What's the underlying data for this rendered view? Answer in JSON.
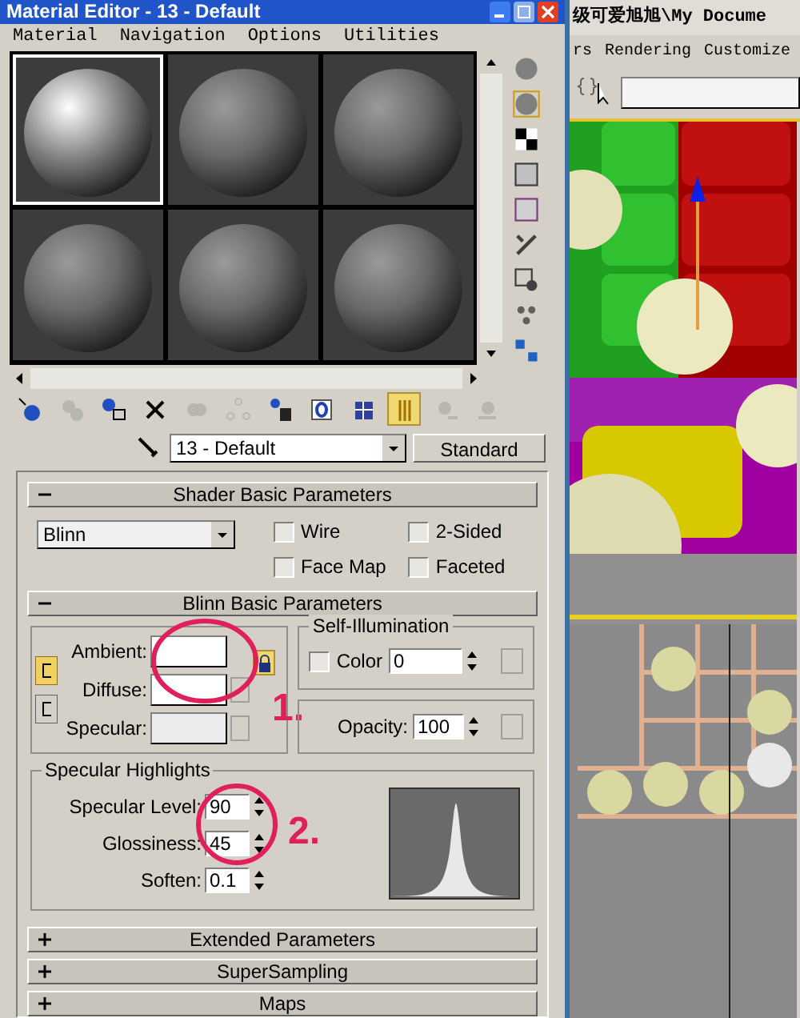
{
  "material_editor": {
    "title": "Material Editor - 13 - Default",
    "menu": [
      "Material",
      "Navigation",
      "Options",
      "Utilities"
    ],
    "sample_slots": [
      {
        "selected": true
      },
      {
        "selected": false
      },
      {
        "selected": false
      },
      {
        "selected": false
      },
      {
        "selected": false
      },
      {
        "selected": false
      }
    ],
    "toolbar": [
      {
        "pressed": false,
        "disabled": false
      },
      {
        "pressed": false,
        "disabled": true
      },
      {
        "pressed": false,
        "disabled": false
      },
      {
        "pressed": false,
        "disabled": false
      },
      {
        "pressed": false,
        "disabled": true
      },
      {
        "pressed": false,
        "disabled": true
      },
      {
        "pressed": false,
        "disabled": false
      },
      {
        "pressed": false,
        "disabled": false
      },
      {
        "pressed": false,
        "disabled": false
      },
      {
        "pressed": true,
        "disabled": false
      },
      {
        "pressed": false,
        "disabled": true
      },
      {
        "pressed": false,
        "disabled": true
      }
    ],
    "material_name": "13 - Default",
    "material_type": "Standard",
    "shader_basic": {
      "title": "Shader Basic Parameters",
      "expanded": true,
      "shader": "Blinn",
      "checkboxes": [
        {
          "label": "Wire",
          "checked": false
        },
        {
          "label": "2-Sided",
          "checked": false
        },
        {
          "label": "Face Map",
          "checked": false
        },
        {
          "label": "Faceted",
          "checked": false
        }
      ]
    },
    "blinn_basic": {
      "title": "Blinn Basic Parameters",
      "expanded": true,
      "colors": [
        {
          "label": "Ambient:"
        },
        {
          "label": "Diffuse:"
        },
        {
          "label": "Specular:"
        }
      ],
      "color_lock": {
        "pressed": true
      },
      "self_illumination": {
        "title": "Self-Illumination",
        "label": "Color",
        "checked": false,
        "value": "0"
      },
      "opacity": {
        "label": "Opacity:",
        "value": "100"
      },
      "specular_highlights": {
        "title": "Specular Highlights",
        "params": [
          {
            "label": "Specular Level:",
            "value": "90"
          },
          {
            "label": "Glossiness:",
            "value": "45"
          },
          {
            "label": "Soften:",
            "value": "0.1"
          }
        ]
      }
    },
    "collapsed_rollouts": [
      {
        "title": "Extended Parameters",
        "expanded": false
      },
      {
        "title": "SuperSampling",
        "expanded": false
      },
      {
        "title": "Maps",
        "expanded": false
      }
    ],
    "annotations": [
      "1.",
      "2."
    ]
  },
  "main_window": {
    "title": "级可爱旭旭\\My Docume",
    "menu": [
      "rs",
      "Rendering",
      "Customize"
    ]
  }
}
